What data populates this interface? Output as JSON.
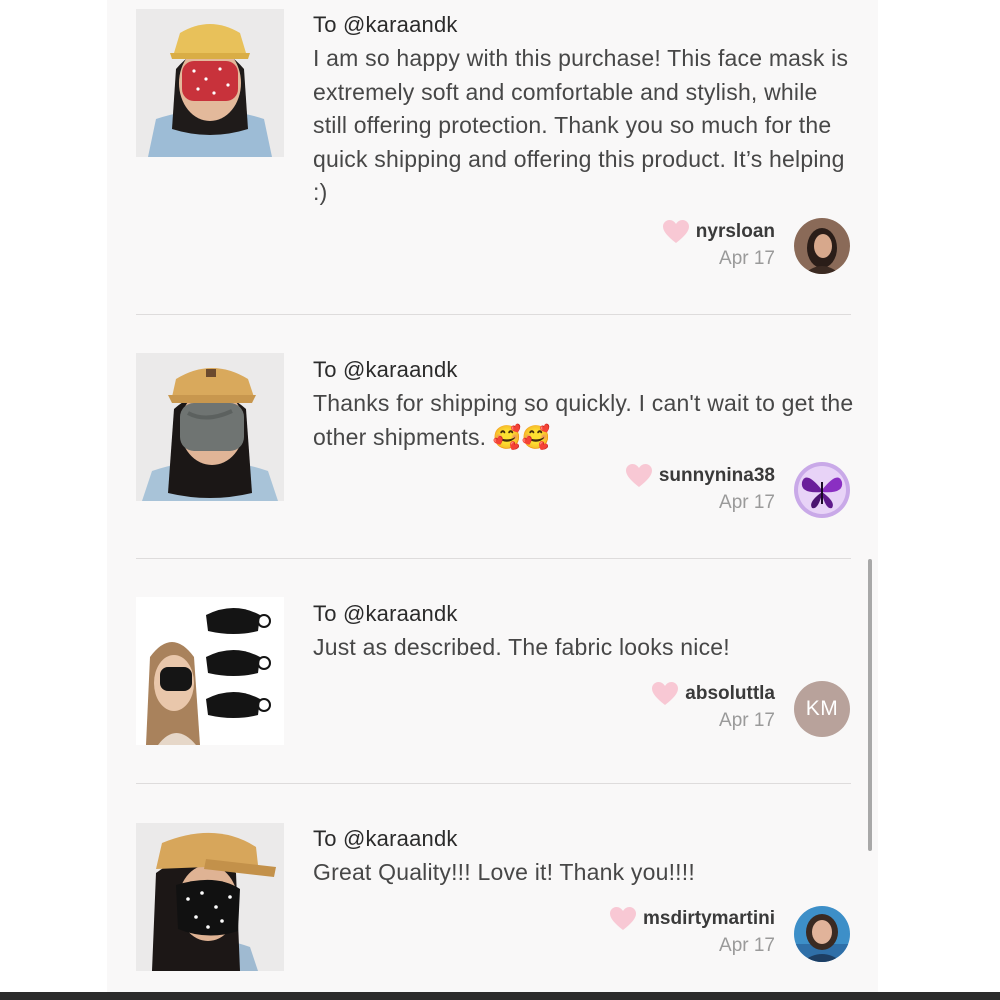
{
  "reviews": [
    {
      "to": "To @karaandk",
      "text": "I am so happy with this purchase! This face mask is extremely soft and comfortable and stylish, while still offering protection. Thank you so much for the quick shipping and offering this product. It’s helping :)",
      "username": "nyrsloan",
      "date": "Apr 17",
      "photo_icon": "red-mask-photo",
      "avatar_icon": "user-photo"
    },
    {
      "to": "To @karaandk",
      "text": "Thanks for shipping so quickly. I can't wait to get the other shipments. 🥰🥰",
      "username": "sunnynina38",
      "date": "Apr 17",
      "photo_icon": "gray-mask-photo",
      "avatar_icon": "butterfly-photo"
    },
    {
      "to": "To @karaandk",
      "text": "Just as described. The fabric looks nice!",
      "username": "absoluttla",
      "date": "Apr 17",
      "avatar_initials": "KM",
      "photo_icon": "black-masks-photo"
    },
    {
      "to": "To @karaandk",
      "text": "Great Quality!!! Love it! Thank you!!!!",
      "username": "msdirtymartini",
      "date": "Apr 17",
      "photo_icon": "star-mask-photo",
      "avatar_icon": "user-photo"
    }
  ],
  "colors": {
    "heart": "#f8c8d4",
    "panel_bg": "#f9f8f8",
    "divider": "#dedcdc",
    "initials_avatar": "#b8a29b"
  }
}
